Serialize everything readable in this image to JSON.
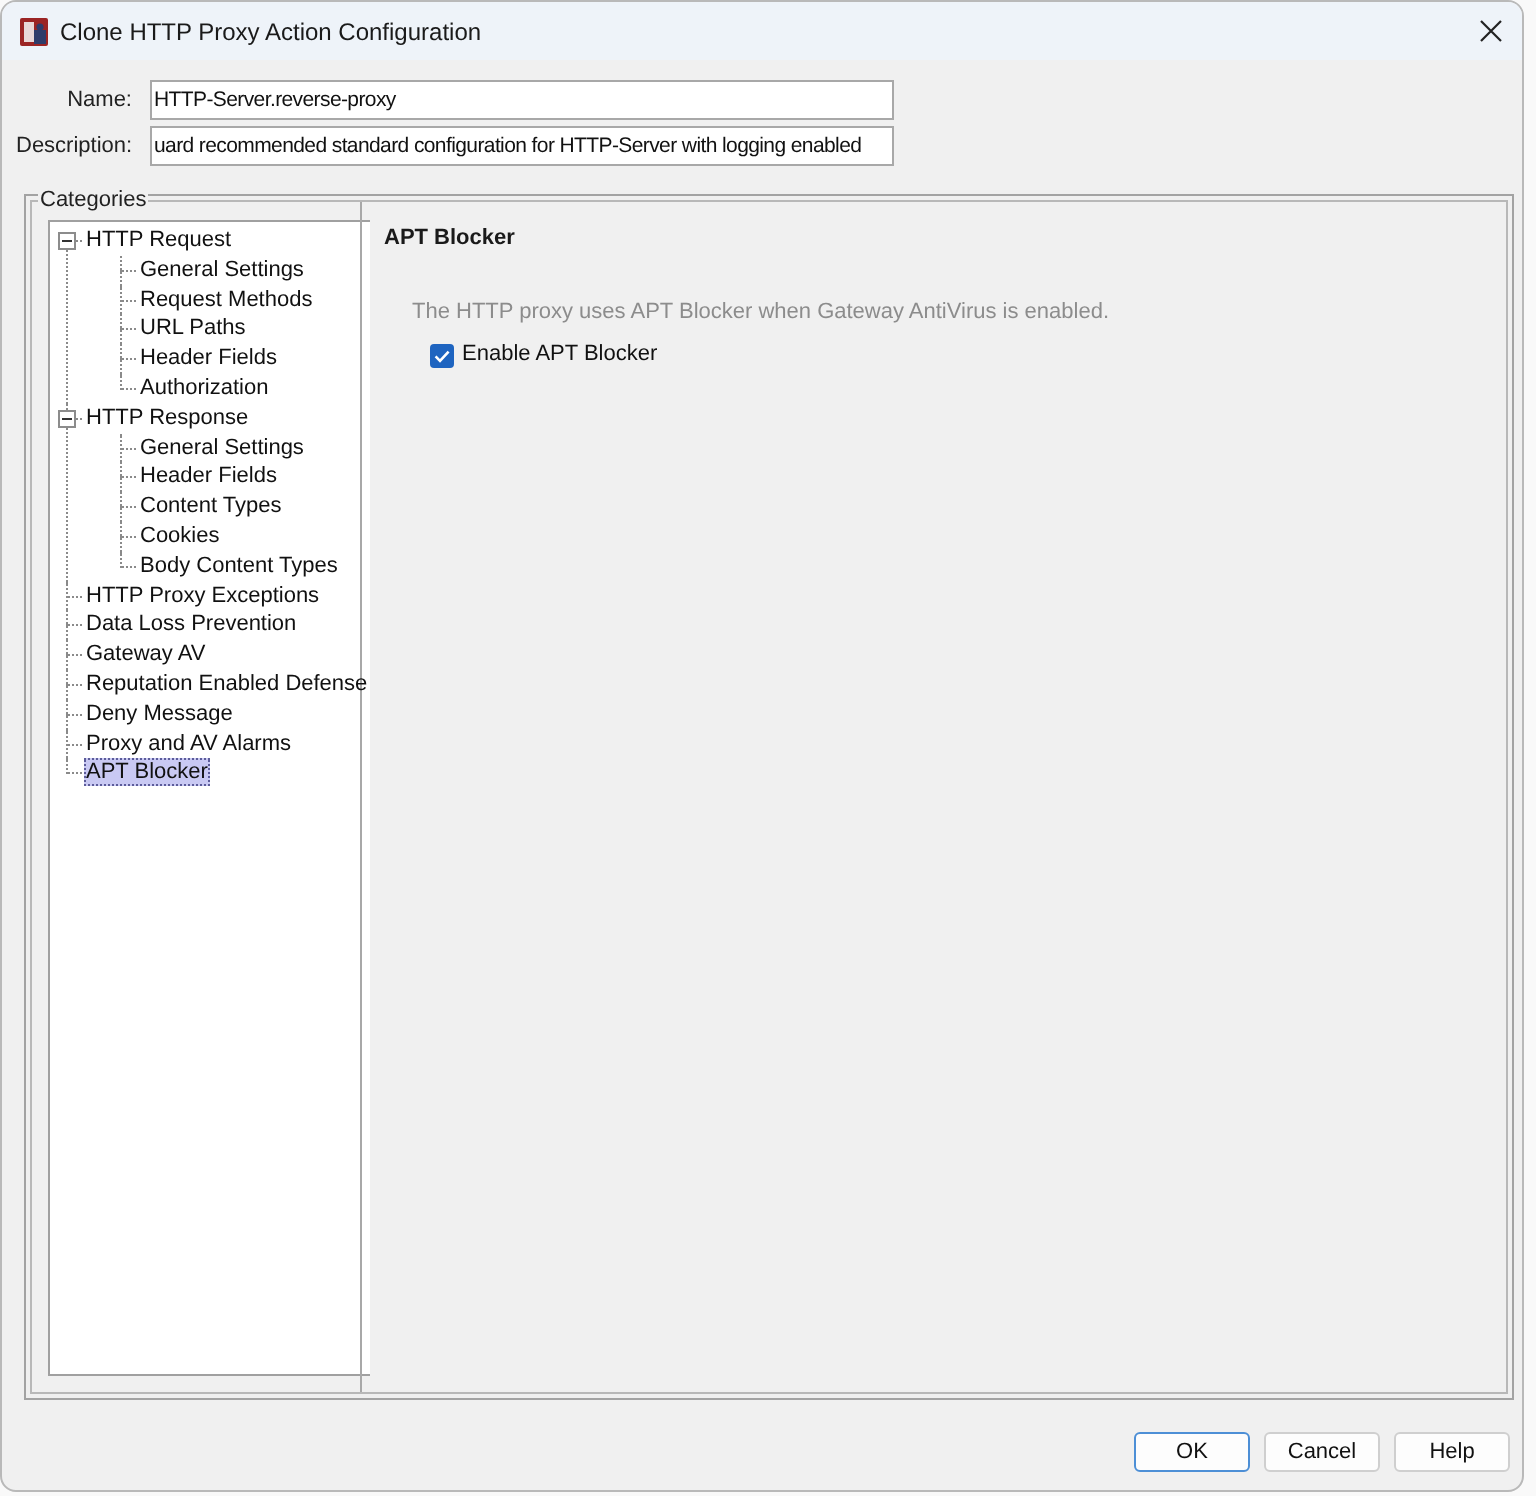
{
  "window": {
    "title": "Clone HTTP Proxy Action Configuration"
  },
  "fields": [
    {
      "label": "Name:",
      "value": "HTTP-Server.reverse-proxy"
    },
    {
      "label": "Description:",
      "value": "uard recommended standard configuration for HTTP-Server with logging enabled"
    }
  ],
  "categories": {
    "legend": "Categories",
    "tree": [
      {
        "label": "HTTP Request",
        "expanded": true,
        "selected": false,
        "children": [
          {
            "label": "General Settings",
            "selected": false
          },
          {
            "label": "Request Methods",
            "selected": false
          },
          {
            "label": "URL Paths",
            "selected": false
          },
          {
            "label": "Header Fields",
            "selected": false
          },
          {
            "label": "Authorization",
            "selected": false
          }
        ]
      },
      {
        "label": "HTTP Response",
        "expanded": true,
        "selected": false,
        "children": [
          {
            "label": "General Settings",
            "selected": false
          },
          {
            "label": "Header Fields",
            "selected": false
          },
          {
            "label": "Content Types",
            "selected": false
          },
          {
            "label": "Cookies",
            "selected": false
          },
          {
            "label": "Body Content Types",
            "selected": false
          }
        ]
      },
      {
        "label": "HTTP Proxy Exceptions",
        "selected": false
      },
      {
        "label": "Data Loss Prevention",
        "selected": false
      },
      {
        "label": "Gateway AV",
        "selected": false
      },
      {
        "label": "Reputation Enabled Defense",
        "selected": false
      },
      {
        "label": "Deny Message",
        "selected": false
      },
      {
        "label": "Proxy and AV Alarms",
        "selected": false
      },
      {
        "label": "APT Blocker",
        "selected": true
      }
    ]
  },
  "panel": {
    "title": "APT Blocker",
    "note": "The HTTP proxy uses APT Blocker when Gateway AntiVirus is enabled.",
    "checkbox": {
      "label": "Enable APT Blocker",
      "checked": true
    }
  },
  "buttons": [
    {
      "label": "OK",
      "default": true
    },
    {
      "label": "Cancel",
      "default": false
    },
    {
      "label": "Help",
      "default": false
    }
  ]
}
